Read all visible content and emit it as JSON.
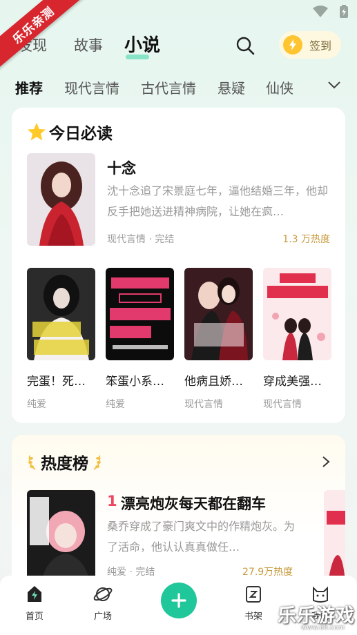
{
  "watermark_ribbon": "乐乐亲测",
  "top_tabs": [
    "发现",
    "故事",
    "小说"
  ],
  "active_top_tab": "小说",
  "signin": {
    "label": "签到"
  },
  "categories": [
    "推荐",
    "现代言情",
    "古代言情",
    "悬疑",
    "仙侠"
  ],
  "today_read": {
    "title": "今日必读",
    "featured": {
      "title": "十念",
      "desc": "沈十念追了宋景庭七年，逼他结婚三年，他却反手把她送进精神病院，让她在疯…",
      "meta": "现代言情 · 完结",
      "heat": "1.3 万热度"
    },
    "books": [
      {
        "title": "完蛋！死…",
        "category": "纯爱"
      },
      {
        "title": "笨蛋小系…",
        "category": "纯爱"
      },
      {
        "title": "他病且娇…",
        "category": "现代言情"
      },
      {
        "title": "穿成美强…",
        "category": "现代言情"
      }
    ]
  },
  "hot_list": {
    "title": "热度榜",
    "top": {
      "rank": "1",
      "title": "漂亮炮灰每天都在翻车",
      "desc": "桑乔穿成了豪门爽文中的作精炮灰。为了活命，他认认真真做任…",
      "meta": "纯爱 · 完结",
      "heat": "27.9万热度"
    }
  },
  "bottom_nav": [
    {
      "label": "首页"
    },
    {
      "label": "广场"
    },
    {
      "label": "书架"
    },
    {
      "label": "我的"
    }
  ],
  "site_watermark": {
    "text": "乐乐游戏",
    "url": "www.6ll.com"
  },
  "colors": {
    "accent": "#1fc79a",
    "rank": "#ee4560",
    "heat": "#c89a3c",
    "ribbon": "#d8262e"
  }
}
